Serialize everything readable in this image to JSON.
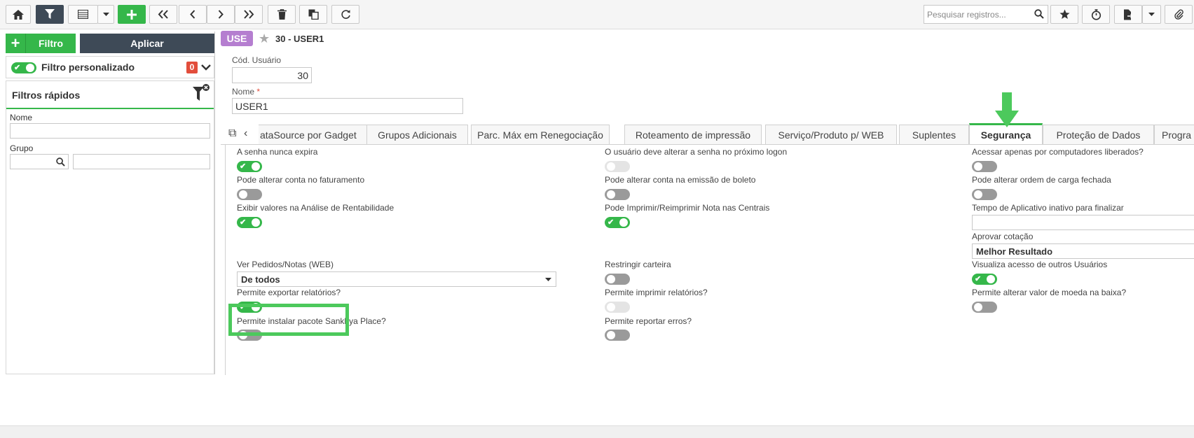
{
  "toolbar": {
    "search_placeholder": "Pesquisar registros...",
    "colors": {
      "dark": "#3e4a57",
      "green": "#35b74a"
    }
  },
  "left": {
    "filtro_label": "Filtro",
    "aplicar_label": "Aplicar",
    "custom_filter_label": "Filtro personalizado",
    "custom_filter_count": "0",
    "quick_filters_title": "Filtros rápidos",
    "nome_label": "Nome",
    "grupo_label": "Grupo"
  },
  "record": {
    "tag": "USE",
    "title": "30 - USER1",
    "cod_label": "Cód. Usuário",
    "cod_value": "30",
    "nome_label": "Nome",
    "nome_required": "*",
    "nome_value": "USER1"
  },
  "tabs": [
    {
      "label": "ataSource por Gadget"
    },
    {
      "label": "Grupos Adicionais"
    },
    {
      "label": "Parc. Máx em Renegociação"
    },
    {
      "label": "Roteamento de impressão"
    },
    {
      "label": "Serviço/Produto p/ WEB"
    },
    {
      "label": "Suplentes"
    },
    {
      "label": "Segurança"
    },
    {
      "label": "Proteção de Dados"
    },
    {
      "label": "Progra"
    }
  ],
  "fields": {
    "senha_nunca_expira": "A senha nunca expira",
    "alterar_senha_logon": "O usuário deve alterar a senha no próximo logon",
    "acessar_computadores": "Acessar apenas por computadores liberados?",
    "alterar_conta_faturamento": "Pode alterar conta no faturamento",
    "alterar_conta_boleto": "Pode alterar conta na emissão de boleto",
    "alterar_ordem_carga": "Pode alterar ordem de carga fechada",
    "exibir_valores_rentabilidade": "Exibir valores na Análise de Rentabilidade",
    "imprimir_nota_centrais": "Pode Imprimir/Reimprimir Nota nas Centrais",
    "tempo_aplicativo_inativo": "Tempo de Aplicativo inativo para finalizar",
    "aprovar_cotacao": "Aprovar cotação",
    "aprovar_cotacao_value": "Melhor Resultado",
    "ver_pedidos_notas": "Ver Pedidos/Notas (WEB)",
    "ver_pedidos_notas_value": "De todos",
    "restringir_carteira": "Restringir carteira",
    "visualiza_acesso": "Visualiza acesso de outros Usuários",
    "permite_exportar": "Permite exportar relatórios?",
    "permite_imprimir": "Permite imprimir relatórios?",
    "permite_alterar_moeda": "Permite alterar valor de moeda na baixa?",
    "permite_instalar_pacote": "Permite instalar pacote Sankhya Place?",
    "permite_reportar_erros": "Permite reportar erros?"
  }
}
